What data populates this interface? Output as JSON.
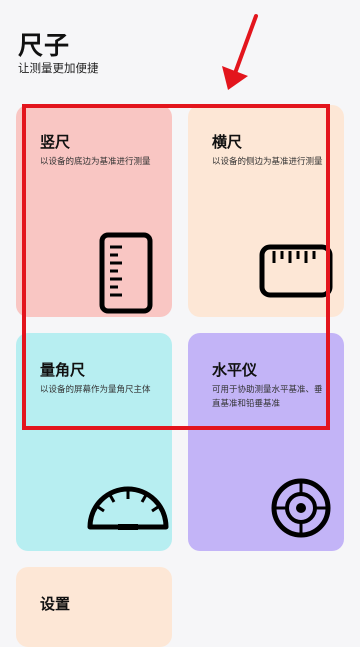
{
  "header": {
    "title": "尺子",
    "subtitle": "让测量更加便捷"
  },
  "cards": [
    {
      "name": "竖尺",
      "desc": "以设备的底边为基准进行测量",
      "icon": "vertical-ruler-icon"
    },
    {
      "name": "横尺",
      "desc": "以设备的侧边为基准进行测量",
      "icon": "horizontal-ruler-icon"
    },
    {
      "name": "量角尺",
      "desc": "以设备的屏幕作为量角尺主体",
      "icon": "protractor-icon"
    },
    {
      "name": "水平仪",
      "desc": "可用于协助测量水平基准、垂直基准和铅垂基准",
      "icon": "level-icon"
    },
    {
      "name": "设置",
      "desc": "",
      "icon": ""
    }
  ],
  "colors": {
    "card1": "#f9c6c3",
    "card2": "#fde7d6",
    "card3": "#b7eef1",
    "card4": "#c3b4f7",
    "annotation": "#e3151d"
  }
}
